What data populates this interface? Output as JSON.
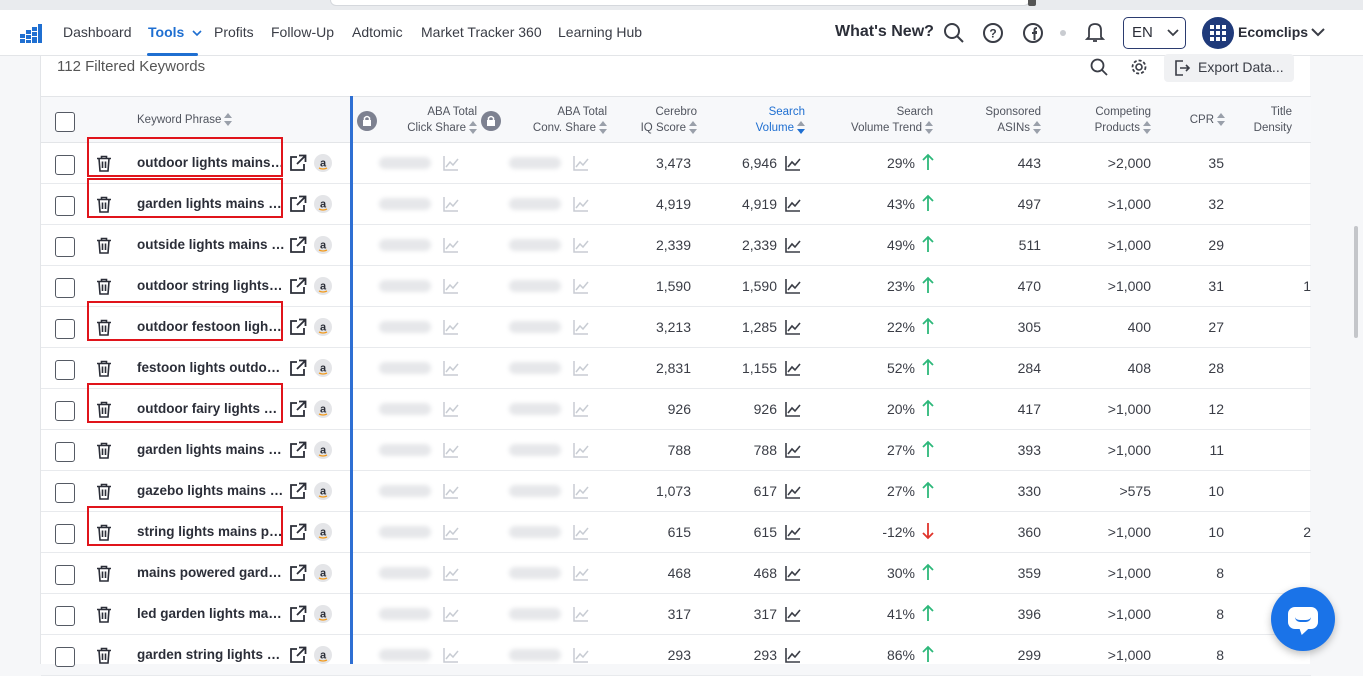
{
  "nav": {
    "items": [
      "Dashboard",
      "Tools",
      "Profits",
      "Follow-Up",
      "Adtomic",
      "Market Tracker 360",
      "Learning Hub"
    ],
    "active": "Tools",
    "whats_new": "What's New?",
    "language": "EN",
    "account": "Ecomclips"
  },
  "toolbar": {
    "filtered_label": "112 Filtered Keywords",
    "export_label": "Export Data..."
  },
  "columns": {
    "keyword": "Keyword Phrase",
    "aba_click_1": "ABA Total",
    "aba_click_2": "Click Share",
    "aba_conv_1": "ABA Total",
    "aba_conv_2": "Conv. Share",
    "cerebro_1": "Cerebro",
    "cerebro_2": "IQ Score",
    "volume_1": "Search",
    "volume_2": "Volume",
    "trend_1": "Search",
    "trend_2": "Volume Trend",
    "sponsored_1": "Sponsored",
    "sponsored_2": "ASINs",
    "competing_1": "Competing",
    "competing_2": "Products",
    "cpr": "CPR",
    "title_1": "Title",
    "title_2": "Density"
  },
  "rows": [
    {
      "keyword": "outdoor lights mains powered",
      "cerebro": "3,473",
      "volume": "6,946",
      "trend": "29%",
      "trend_dir": "up",
      "sponsored": "443",
      "competing": ">2,000",
      "cpr": "35",
      "title_density": "",
      "highlighted": true
    },
    {
      "keyword": "garden lights mains powered",
      "cerebro": "4,919",
      "volume": "4,919",
      "trend": "43%",
      "trend_dir": "up",
      "sponsored": "497",
      "competing": ">1,000",
      "cpr": "32",
      "title_density": "",
      "highlighted": true
    },
    {
      "keyword": "outside lights mains powered",
      "cerebro": "2,339",
      "volume": "2,339",
      "trend": "49%",
      "trend_dir": "up",
      "sponsored": "511",
      "competing": ">1,000",
      "cpr": "29",
      "title_density": "",
      "highlighted": false
    },
    {
      "keyword": "outdoor string lights mains",
      "cerebro": "1,590",
      "volume": "1,590",
      "trend": "23%",
      "trend_dir": "up",
      "sponsored": "470",
      "competing": ">1,000",
      "cpr": "31",
      "title_density": "1",
      "highlighted": false
    },
    {
      "keyword": "outdoor festoon lights mains",
      "cerebro": "3,213",
      "volume": "1,285",
      "trend": "22%",
      "trend_dir": "up",
      "sponsored": "305",
      "competing": "400",
      "cpr": "27",
      "title_density": "",
      "highlighted": true
    },
    {
      "keyword": "festoon lights outdoor mains",
      "cerebro": "2,831",
      "volume": "1,155",
      "trend": "52%",
      "trend_dir": "up",
      "sponsored": "284",
      "competing": "408",
      "cpr": "28",
      "title_density": "",
      "highlighted": false
    },
    {
      "keyword": "outdoor fairy lights mains",
      "cerebro": "926",
      "volume": "926",
      "trend": "20%",
      "trend_dir": "up",
      "sponsored": "417",
      "competing": ">1,000",
      "cpr": "12",
      "title_density": "",
      "highlighted": true
    },
    {
      "keyword": "garden lights mains powered",
      "cerebro": "788",
      "volume": "788",
      "trend": "27%",
      "trend_dir": "up",
      "sponsored": "393",
      "competing": ">1,000",
      "cpr": "11",
      "title_density": "",
      "highlighted": false
    },
    {
      "keyword": "gazebo lights mains powered",
      "cerebro": "1,073",
      "volume": "617",
      "trend": "27%",
      "trend_dir": "up",
      "sponsored": "330",
      "competing": ">575",
      "cpr": "10",
      "title_density": "",
      "highlighted": false
    },
    {
      "keyword": "string lights mains powered",
      "cerebro": "615",
      "volume": "615",
      "trend": "-12%",
      "trend_dir": "down",
      "sponsored": "360",
      "competing": ">1,000",
      "cpr": "10",
      "title_density": "2",
      "highlighted": true
    },
    {
      "keyword": "mains powered garden lights",
      "cerebro": "468",
      "volume": "468",
      "trend": "30%",
      "trend_dir": "up",
      "sponsored": "359",
      "competing": ">1,000",
      "cpr": "8",
      "title_density": "",
      "highlighted": false
    },
    {
      "keyword": "led garden lights mains powered",
      "cerebro": "317",
      "volume": "317",
      "trend": "41%",
      "trend_dir": "up",
      "sponsored": "396",
      "competing": ">1,000",
      "cpr": "8",
      "title_density": "",
      "highlighted": false
    },
    {
      "keyword": "garden string lights mains",
      "cerebro": "293",
      "volume": "293",
      "trend": "86%",
      "trend_dir": "up",
      "sponsored": "299",
      "competing": ">1,000",
      "cpr": "8",
      "title_density": "",
      "highlighted": false
    }
  ],
  "colors": {
    "accent": "#1f6fd1",
    "up": "#2db87a",
    "down": "#e0342b",
    "highlight_box": "#e0141b"
  }
}
